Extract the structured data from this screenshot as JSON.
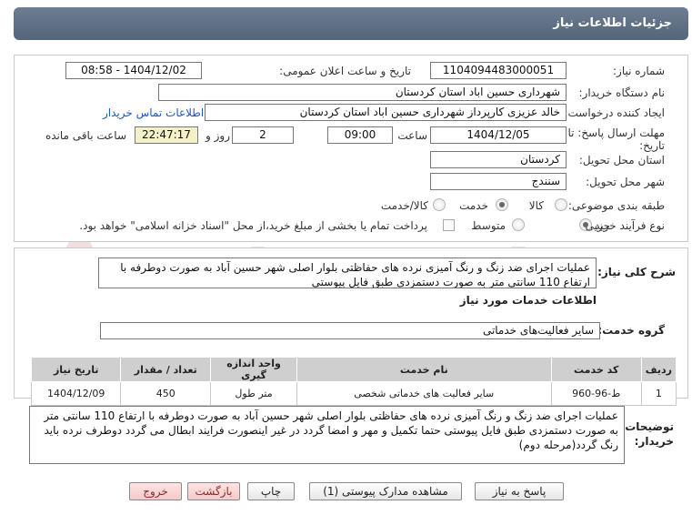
{
  "window": {
    "title": "جزئیات اطلاعات نیاز"
  },
  "form": {
    "need_number_label": "شماره نیاز:",
    "need_number": "1104094483000051",
    "announce_label": "تاریخ و ساعت اعلان عمومی:",
    "announce_value": "1404/12/02 - 08:58",
    "buyer_org_label": "نام دستگاه خریدار:",
    "buyer_org": "شهرداری حسین اباد استان کردستان",
    "requester_label": "ایجاد کننده درخواست:",
    "requester": "خالد عزیزی کارپرداز شهرداری حسین اباد استان کردستان",
    "contact_link": "اطلاعات تماس خریدار",
    "deadline_label_1": "مهلت ارسال پاسخ: تا",
    "deadline_label_2": "تاریخ:",
    "deadline_date": "1404/12/05",
    "time_label": "ساعت",
    "deadline_time": "09:00",
    "days_value": "2",
    "days_label": "روز و",
    "remaining_time": "22:47:17",
    "remaining_label": "ساعت باقی مانده",
    "province_label": "استان محل تحویل:",
    "province": "کردستان",
    "city_label": "شهر محل تحویل:",
    "city": "سنندج",
    "category_label": "طبقه بندی موضوعی:",
    "category_options": [
      "کالا",
      "خدمت",
      "کالا/خدمت"
    ],
    "category_selected": "خدمت",
    "process_label": "نوع فرآیند خرید :",
    "process_options": [
      "جزیی",
      "متوسط"
    ],
    "process_selected": "جزیی",
    "payment_text": "پرداخت تمام یا بخشی از مبلغ خرید،از محل \"اسناد خزانه اسلامی\" خواهد بود."
  },
  "summary": {
    "label": "شرح کلی نیاز:",
    "text": "عملیات اجرای ضد زنگ و رنگ آمیزی نرده های حفاظتی بلوار اصلی شهر حسین آباد به صورت دوطرفه با ارتفاع 110 سانتی متر به صورت دستمزدی طبق فایل پیوستی"
  },
  "services": {
    "section_title": "اطلاعات خدمات مورد نیاز",
    "group_label": "گروه خدمت:",
    "group_value": "سایر فعالیت‌های خدماتی",
    "columns": [
      "ردیف",
      "کد خدمت",
      "نام خدمت",
      "واحد اندازه گیری",
      "تعداد / مقدار",
      "تاریخ نیاز"
    ],
    "rows": [
      {
        "row": "1",
        "code": "ط-96-960",
        "name": "سایر فعالیت های خدماتی شخصی",
        "unit": "متر طول",
        "qty": "450",
        "date": "1404/12/09"
      }
    ]
  },
  "buyer_notes": {
    "label_1": "توضیحات",
    "label_2": "خریدار:",
    "text": "عملیات اجرای ضد زنگ و رنگ آمیزی نرده های حفاظتی بلوار اصلی شهر حسین آباد به صورت دوطرفه با ارتفاع 110 سانتی متر به صورت دستمزدی طبق فایل پیوستی حتما تکمیل و مهر و امضا گردد در غیر اینصورت فرایند ابطال می گردد دوطرف نرده باید رنگ گردد(مرحله دوم)"
  },
  "buttons": {
    "reply": "پاسخ به نیاز",
    "attachments": "مشاهده مدارک پیوستی (1)",
    "print": "چاپ",
    "back": "بازگشت",
    "exit": "خروج"
  },
  "watermark": {
    "text": "AriaTender.net"
  },
  "colors": {
    "title_bar": "#5f6f83",
    "link": "#1a56c9",
    "yellow_field": "#f4f0c8",
    "table_header": "#cfcfcf"
  }
}
